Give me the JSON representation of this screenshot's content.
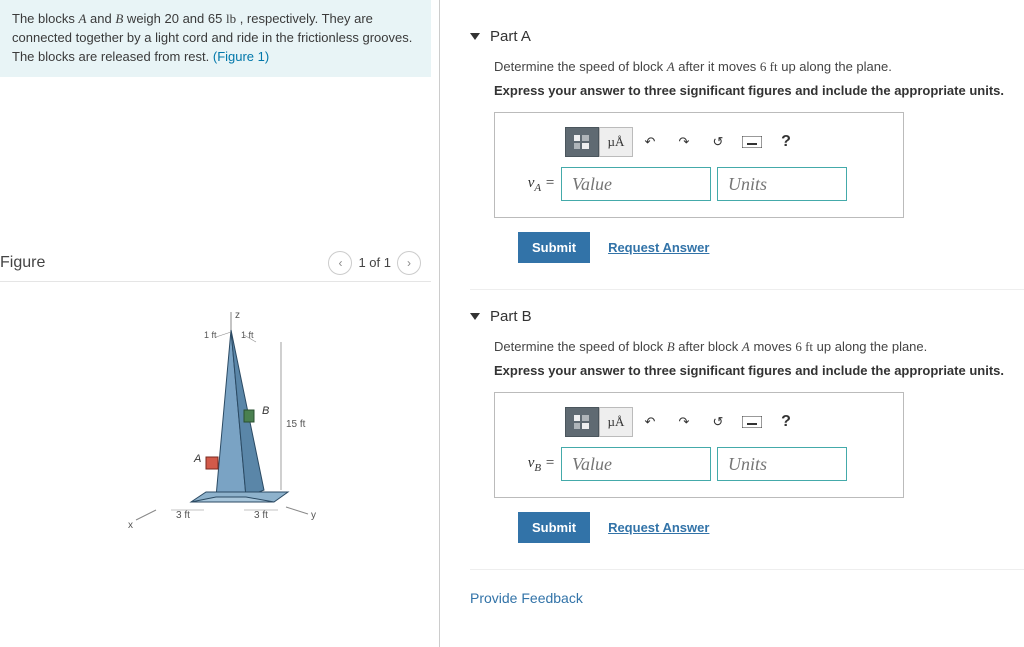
{
  "problem": {
    "text_prefix": "The blocks ",
    "varA": "A",
    "text_mid1": " and ",
    "varB": "B",
    "text_mid2": " weigh 20 and 65 ",
    "unit": "lb",
    "text_mid3": " , respectively. They are connected together by a light cord and ride in the frictionless grooves. The blocks are released from rest. ",
    "figlink": "(Figure 1)"
  },
  "figure": {
    "title": "Figure",
    "pager": "1 of 1",
    "labels": {
      "z": "z",
      "x": "x",
      "y": "y",
      "A": "A",
      "B": "B",
      "h": "15 ft",
      "base1": "3 ft",
      "base2": "3 ft",
      "top1": "1 ft",
      "top2": "1 ft"
    }
  },
  "parts": [
    {
      "title": "Part A",
      "prompt_pre": "Determine the speed of block ",
      "prompt_var": "A",
      "prompt_mid": " after it moves ",
      "prompt_dist": "6 ft",
      "prompt_post": " up along the plane.",
      "instruct": "Express your answer to three significant figures and include the appropriate units.",
      "var_label_html": "v<sub>A</sub> =",
      "value_ph": "Value",
      "units_ph": "Units",
      "submit": "Submit",
      "request": "Request Answer"
    },
    {
      "title": "Part B",
      "prompt_pre": "Determine the speed of block ",
      "prompt_var": "B",
      "prompt_mid": " after block ",
      "prompt_var2": "A",
      "prompt_mid2": " moves ",
      "prompt_dist": "6 ft",
      "prompt_post": " up along the plane.",
      "instruct": "Express your answer to three significant figures and include the appropriate units.",
      "var_label_html": "v<sub>B</sub> =",
      "value_ph": "Value",
      "units_ph": "Units",
      "submit": "Submit",
      "request": "Request Answer"
    }
  ],
  "toolbar": {
    "units_btn": "µÅ",
    "help": "?"
  },
  "feedback": "Provide Feedback"
}
